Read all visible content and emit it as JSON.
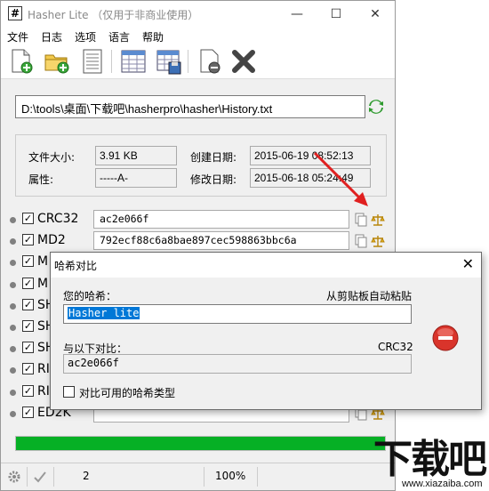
{
  "window": {
    "title": "Hasher Lite （仅用于非商业使用）",
    "icon_char": "#",
    "controls": [
      "minimize",
      "maximize",
      "close"
    ]
  },
  "menu": [
    "文件",
    "日志",
    "选项",
    "语言",
    "帮助"
  ],
  "toolbar_icons": [
    "new-file-icon",
    "open-folder-icon",
    "document-icon",
    "table-icon",
    "save-table-icon",
    "remove-file-icon",
    "delete-x-icon"
  ],
  "path": "D:\\tools\\桌面\\下载吧\\hasherpro\\hasher\\History.txt",
  "info": {
    "size_label": "文件大小:",
    "size_value": "3.91 KB",
    "attr_label": "属性:",
    "attr_value": "-----A-",
    "created_label": "创建日期:",
    "created_value": "2015-06-19 08:52:13",
    "modified_label": "修改日期:",
    "modified_value": "2015-06-18 05:24:49"
  },
  "hashes": [
    {
      "algo": "CRC32",
      "value": "ac2e066f"
    },
    {
      "algo": "MD2",
      "value": "792ecf88c6a8bae897cec598863bbc6a"
    },
    {
      "algo": "M",
      "value": ""
    },
    {
      "algo": "M",
      "value": ""
    },
    {
      "algo": "SH",
      "value": ""
    },
    {
      "algo": "SH",
      "value": ""
    },
    {
      "algo": "SH",
      "value": ""
    },
    {
      "algo": "RI",
      "value": ""
    },
    {
      "algo": "RI",
      "value": ""
    },
    {
      "algo": "ED2K",
      "value": ""
    }
  ],
  "progress_percent": 100,
  "status": {
    "count": "2",
    "percent": "100%"
  },
  "dialog": {
    "title": "哈希对比",
    "your_hash_label": "您的哈希：",
    "auto_paste_label": "从剪贴板自动粘贴",
    "your_hash_value": "Hasher lite",
    "compare_label": "与以下对比：",
    "compare_algo": "CRC32",
    "compare_value": "ac2e066f",
    "checkbox_label": "对比可用的哈希类型",
    "close_char": "✕"
  },
  "watermark": {
    "big": "下载吧",
    "small": "www.xiazaiba.com"
  },
  "colors": {
    "progress": "#06b025",
    "selection": "#0078d7",
    "arrow": "#e02020",
    "stop": "#d9342b"
  }
}
